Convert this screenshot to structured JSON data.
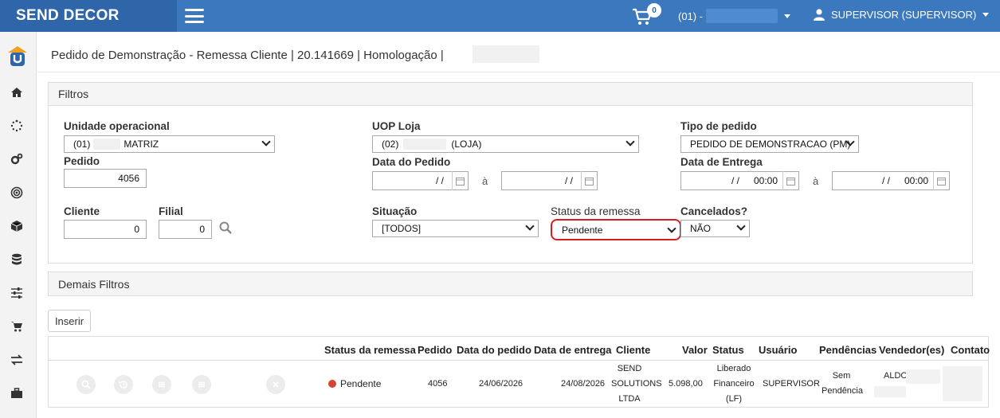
{
  "app": {
    "brand": "SEND DECOR",
    "cart_count": "0",
    "store_label": "(01) -",
    "user_label": "SUPERVISOR (SUPERVISOR)"
  },
  "header": {
    "title": "Pedido de Demonstração - Remessa Cliente | 20.141669 | Homologação |"
  },
  "filters": {
    "panel_title": "Filtros",
    "unidade_label": "Unidade operacional",
    "unidade_code": "(01)",
    "unidade_name": "MATRIZ",
    "uop_label": "UOP Loja",
    "uop_code": "(02)",
    "uop_name": "(LOJA)",
    "tipo_label": "Tipo de pedido",
    "tipo_value": "PEDIDO DE DEMONSTRACAO (PM)",
    "pedido_label": "Pedido",
    "pedido_value": "4056",
    "data_pedido_label": "Data do Pedido",
    "data_pedido_from": "/ /",
    "data_pedido_to": "/ /",
    "date_sep": "à",
    "data_entrega_label": "Data de Entrega",
    "data_entrega_from_date": "/ /",
    "data_entrega_from_time": "00:00",
    "data_entrega_to_date": "/ /",
    "data_entrega_to_time": "00:00",
    "cliente_label": "Cliente",
    "cliente_value": "0",
    "filial_label": "Filial",
    "filial_value": "0",
    "situacao_label": "Situação",
    "situacao_value": "[TODOS]",
    "status_remessa_label": "Status da remessa",
    "status_remessa_value": "Pendente",
    "cancelados_label": "Cancelados?",
    "cancelados_value": "NÃO"
  },
  "other_filters": {
    "panel_title": "Demais Filtros"
  },
  "actions": {
    "insert_label": "Inserir"
  },
  "table": {
    "columns": [
      "Status da remessa",
      "Pedido",
      "Data do pedido",
      "Data de entrega",
      "Cliente",
      "Valor",
      "Status",
      "Usuário",
      "Pendências",
      "Vendedor(es)",
      "Contato"
    ],
    "rows": [
      {
        "status_remessa": "Pendente",
        "status_color": "#d4452f",
        "pedido": "4056",
        "data_pedido": "24/06/2026",
        "data_entrega": "24/08/2026",
        "cliente_l1": "SEND",
        "cliente_l2": "SOLUTIONS",
        "cliente_l3": "LTDA",
        "valor": "5.098,00",
        "status_l1": "Liberado",
        "status_l2": "Financeiro",
        "status_l3": "(LF)",
        "usuario": "SUPERVISOR",
        "pendencias_l1": "Sem",
        "pendencias_l2": "Pendência",
        "vendedor": "ALDO"
      }
    ]
  },
  "colors": {
    "topbar": "#3c78be",
    "brand_bg": "#2f66aa",
    "highlight": "#d42020",
    "pending": "#d4452f"
  },
  "icons": [
    "menu-icon",
    "cart-icon",
    "user-icon",
    "home-icon",
    "spinner-icon",
    "gears-icon",
    "target-icon",
    "cube-icon",
    "database-icon",
    "sliders-icon",
    "shopping-cart-icon",
    "exchange-icon",
    "briefcase-icon",
    "search-icon",
    "calendar-icon",
    "history-icon",
    "list-icon",
    "close-icon"
  ]
}
